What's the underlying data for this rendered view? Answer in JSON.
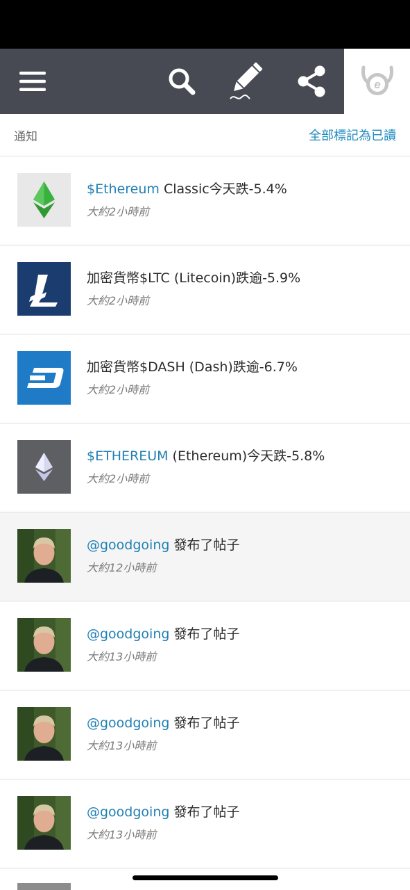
{
  "header": {
    "menu_icon": "hamburger-menu-icon",
    "search_icon": "search-icon",
    "edit_icon": "pencil-icon",
    "share_icon": "share-icon",
    "logo_icon": "etoro-logo-icon"
  },
  "subheader": {
    "title": "通知",
    "mark_all_read": "全部標記為已讀"
  },
  "notifications": [
    {
      "link": "$Ethereum",
      "text": " Classic今天跌-5.4%",
      "time": "大約2小時前",
      "icon": "ethereum-classic-icon",
      "unread": false
    },
    {
      "link": "",
      "text": "加密貨幣$LTC (Litecoin)跌逾-5.9%",
      "time": "大約2小時前",
      "icon": "litecoin-icon",
      "unread": false
    },
    {
      "link": "",
      "text": "加密貨幣$DASH (Dash)跌逾-6.7%",
      "time": "大約2小時前",
      "icon": "dash-icon",
      "unread": false
    },
    {
      "link": "$ETHEREUM",
      "text": " (Ethereum)今天跌-5.8%",
      "time": "大約2小時前",
      "icon": "ethereum-icon",
      "unread": false
    },
    {
      "link": "@goodgoing",
      "text": " 發布了帖子",
      "time": "大約12小時前",
      "icon": "user-avatar",
      "unread": true
    },
    {
      "link": "@goodgoing",
      "text": " 發布了帖子",
      "time": "大約13小時前",
      "icon": "user-avatar",
      "unread": false
    },
    {
      "link": "@goodgoing",
      "text": " 發布了帖子",
      "time": "大約13小時前",
      "icon": "user-avatar",
      "unread": false
    },
    {
      "link": "@goodgoing",
      "text": " 發布了帖子",
      "time": "大約13小時前",
      "icon": "user-avatar",
      "unread": false
    }
  ],
  "colors": {
    "header_bg": "#474a52",
    "link": "#1f7fb3",
    "litecoin_bg": "#1b3c6e",
    "dash_bg": "#1f7bc6",
    "ethereum_bg": "#5e5f62",
    "etc_green": "#3ab03e"
  }
}
